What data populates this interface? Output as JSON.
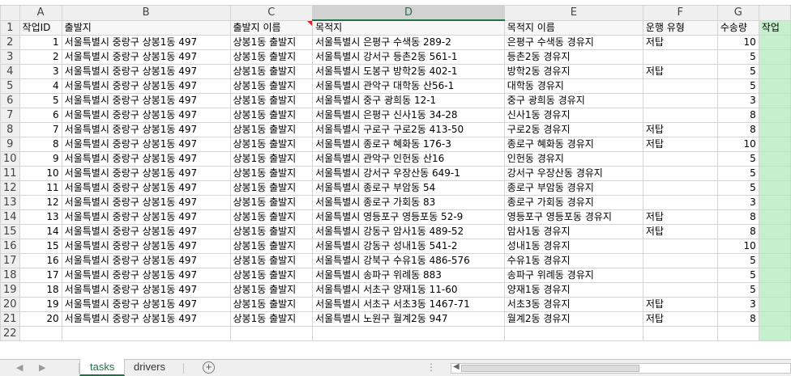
{
  "columns": [
    "A",
    "B",
    "C",
    "D",
    "E",
    "F",
    "G",
    ""
  ],
  "selected_column": "D",
  "header_row": [
    "작업ID",
    "출발지",
    "출발지 이름",
    "목적지",
    "목적지 이름",
    "운행 유형",
    "수송량",
    "작업"
  ],
  "rows": [
    {
      "id": "1",
      "origin": "서울특별시 중랑구 상봉1동 497",
      "origin_name": "상봉1동 출발지",
      "dest": "서울특별시 은평구 수색동 289-2",
      "dest_name": "은평구 수색동 경유지",
      "type": "저탑",
      "qty": "10"
    },
    {
      "id": "2",
      "origin": "서울특별시 중랑구 상봉1동 497",
      "origin_name": "상봉1동 출발지",
      "dest": "서울특별시 강서구 등촌2동 561-1",
      "dest_name": "등촌2동 경유지",
      "type": "",
      "qty": "5"
    },
    {
      "id": "3",
      "origin": "서울특별시 중랑구 상봉1동 497",
      "origin_name": "상봉1동 출발지",
      "dest": "서울특별시 도봉구 방학2동 402-1",
      "dest_name": "방학2동 경유지",
      "type": "저탑",
      "qty": "5"
    },
    {
      "id": "4",
      "origin": "서울특별시 중랑구 상봉1동 497",
      "origin_name": "상봉1동 출발지",
      "dest": "서울특별시 관악구 대학동 산56-1",
      "dest_name": "대학동 경유지",
      "type": "",
      "qty": "5"
    },
    {
      "id": "5",
      "origin": "서울특별시 중랑구 상봉1동 497",
      "origin_name": "상봉1동 출발지",
      "dest": "서울특별시 중구 광희동 12-1",
      "dest_name": "중구 광희동 경유지",
      "type": "",
      "qty": "3"
    },
    {
      "id": "6",
      "origin": "서울특별시 중랑구 상봉1동 497",
      "origin_name": "상봉1동 출발지",
      "dest": "서울특별시 은평구 신사1동 34-28",
      "dest_name": "신사1동 경유지",
      "type": "",
      "qty": "8"
    },
    {
      "id": "7",
      "origin": "서울특별시 중랑구 상봉1동 497",
      "origin_name": "상봉1동 출발지",
      "dest": "서울특별시 구로구 구로2동 413-50",
      "dest_name": "구로2동 경유지",
      "type": "저탑",
      "qty": "8"
    },
    {
      "id": "8",
      "origin": "서울특별시 중랑구 상봉1동 497",
      "origin_name": "상봉1동 출발지",
      "dest": "서울특별시 종로구 혜화동 176-3",
      "dest_name": "종로구 혜화동 경유지",
      "type": "저탑",
      "qty": "10"
    },
    {
      "id": "9",
      "origin": "서울특별시 중랑구 상봉1동 497",
      "origin_name": "상봉1동 출발지",
      "dest": "서울특별시 관악구 인헌동 산16",
      "dest_name": "인헌동 경유지",
      "type": "",
      "qty": "5"
    },
    {
      "id": "10",
      "origin": "서울특별시 중랑구 상봉1동 497",
      "origin_name": "상봉1동 출발지",
      "dest": "서울특별시 강서구 우장산동 649-1",
      "dest_name": "강서구 우장산동 경유지",
      "type": "",
      "qty": "5"
    },
    {
      "id": "11",
      "origin": "서울특별시 중랑구 상봉1동 497",
      "origin_name": "상봉1동 출발지",
      "dest": "서울특별시 종로구 부암동 54",
      "dest_name": "종로구 부암동 경유지",
      "type": "",
      "qty": "5"
    },
    {
      "id": "12",
      "origin": "서울특별시 중랑구 상봉1동 497",
      "origin_name": "상봉1동 출발지",
      "dest": "서울특별시 종로구 가회동 83",
      "dest_name": "종로구 가회동 경유지",
      "type": "",
      "qty": "3"
    },
    {
      "id": "13",
      "origin": "서울특별시 중랑구 상봉1동 497",
      "origin_name": "상봉1동 출발지",
      "dest": "서울특별시 영등포구 영등포동 52-9",
      "dest_name": "영등포구 영등포동 경유지",
      "type": "저탑",
      "qty": "8"
    },
    {
      "id": "14",
      "origin": "서울특별시 중랑구 상봉1동 497",
      "origin_name": "상봉1동 출발지",
      "dest": "서울특별시 강동구 암사1동 489-52",
      "dest_name": "암사1동 경유지",
      "type": "저탑",
      "qty": "8"
    },
    {
      "id": "15",
      "origin": "서울특별시 중랑구 상봉1동 497",
      "origin_name": "상봉1동 출발지",
      "dest": "서울특별시 강동구 성내1동 541-2",
      "dest_name": "성내1동 경유지",
      "type": "",
      "qty": "10"
    },
    {
      "id": "16",
      "origin": "서울특별시 중랑구 상봉1동 497",
      "origin_name": "상봉1동 출발지",
      "dest": "서울특별시 강북구 수유1동 486-576",
      "dest_name": "수유1동 경유지",
      "type": "",
      "qty": "5"
    },
    {
      "id": "17",
      "origin": "서울특별시 중랑구 상봉1동 497",
      "origin_name": "상봉1동 출발지",
      "dest": "서울특별시 송파구 위례동 883",
      "dest_name": "송파구 위례동 경유지",
      "type": "",
      "qty": "5"
    },
    {
      "id": "18",
      "origin": "서울특별시 중랑구 상봉1동 497",
      "origin_name": "상봉1동 출발지",
      "dest": "서울특별시 서초구 양재1동 11-60",
      "dest_name": "양재1동 경유지",
      "type": "",
      "qty": "5"
    },
    {
      "id": "19",
      "origin": "서울특별시 중랑구 상봉1동 497",
      "origin_name": "상봉1동 출발지",
      "dest": "서울특별시 서초구 서초3동 1467-71",
      "dest_name": "서초3동 경유지",
      "type": "저탑",
      "qty": "3"
    },
    {
      "id": "20",
      "origin": "서울특별시 중랑구 상봉1동 497",
      "origin_name": "상봉1동 출발지",
      "dest": "서울특별시 노원구 월계2동 947",
      "dest_name": "월계2동 경유지",
      "type": "저탑",
      "qty": "8"
    }
  ],
  "sheet_tabs": [
    "tasks",
    "drivers"
  ],
  "active_tab": "tasks",
  "icons": {
    "add_sheet": "plus-circle-icon",
    "scroll_left": "scroll-left-icon"
  }
}
